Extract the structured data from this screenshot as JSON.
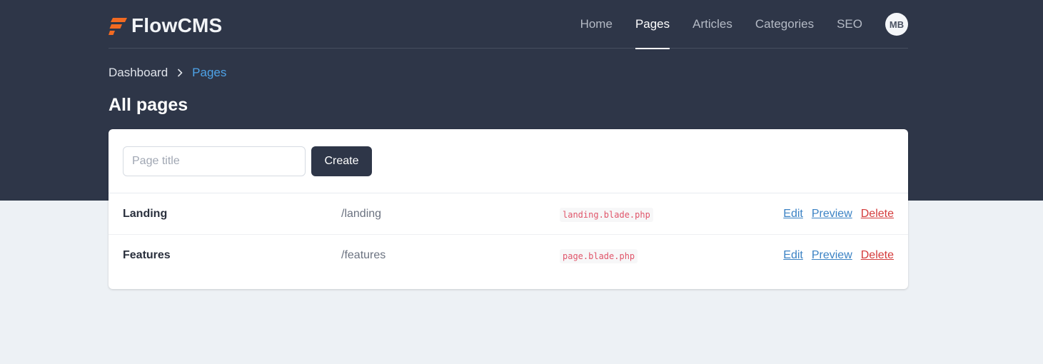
{
  "app": {
    "brand": "FlowCMS",
    "logo_icon": "flow-logo-icon"
  },
  "nav": {
    "items": [
      {
        "label": "Home",
        "active": false
      },
      {
        "label": "Pages",
        "active": true
      },
      {
        "label": "Articles",
        "active": false
      },
      {
        "label": "Categories",
        "active": false
      },
      {
        "label": "SEO",
        "active": false
      }
    ],
    "avatar_initials": "MB"
  },
  "breadcrumb": {
    "parent": "Dashboard",
    "separator_icon": "chevron-right-icon",
    "current": "Pages"
  },
  "page_title": "All pages",
  "create_form": {
    "input_value": "",
    "input_placeholder": "Page title",
    "button_label": "Create"
  },
  "pages": [
    {
      "name": "Landing",
      "slug": "/landing",
      "template": "landing.blade.php",
      "actions": {
        "edit": "Edit",
        "preview": "Preview",
        "delete": "Delete"
      }
    },
    {
      "name": "Features",
      "slug": "/features",
      "template": "page.blade.php",
      "actions": {
        "edit": "Edit",
        "preview": "Preview",
        "delete": "Delete"
      }
    }
  ],
  "colors": {
    "header_bg": "#2e3648",
    "page_bg": "#edf1f5",
    "accent_orange": "#f26a21",
    "breadcrumb_active": "#4ea3e8",
    "link_blue": "#3b82c4",
    "danger_red": "#d43c3c",
    "template_code": "#e0556a"
  }
}
